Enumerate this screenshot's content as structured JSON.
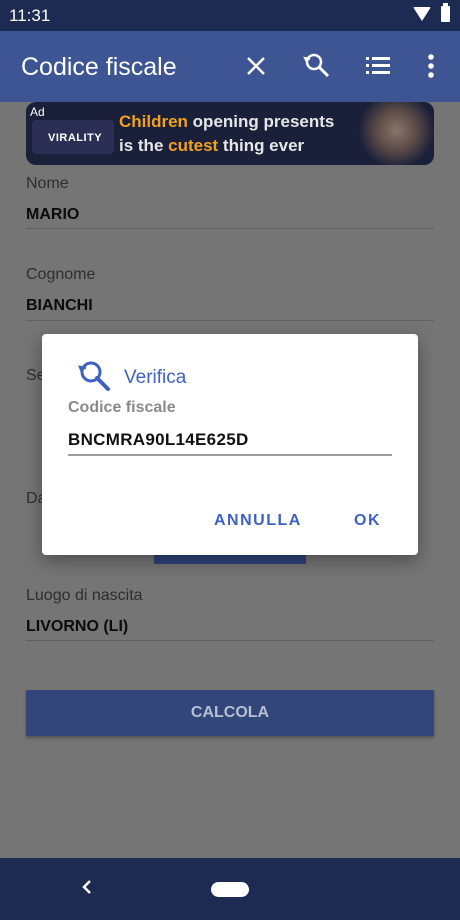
{
  "status_bar": {
    "time": "11:31"
  },
  "app_bar": {
    "title": "Codice fiscale",
    "icons": [
      "close-icon",
      "search-icon",
      "list-icon",
      "more-vert-icon"
    ]
  },
  "ad": {
    "badge": "Ad",
    "brand": "VIRALITY",
    "line1_a": "Children",
    "line1_b": " opening presents",
    "line2_a": "is the ",
    "line2_b": "cutest",
    "line2_c": " thing ever"
  },
  "form": {
    "nome_label": "Nome",
    "nome_value": "MARIO",
    "cognome_label": "Cognome",
    "cognome_value": "BIANCHI",
    "sesso_partial": "Se",
    "data_partial": "Da",
    "luogo_label": "Luogo di nascita",
    "luogo_value": "LIVORNO (LI)",
    "calcola_label": "CALCOLA"
  },
  "dialog": {
    "title": "Verifica",
    "field_label": "Codice fiscale",
    "field_value": "BNCMRA90L14E625D",
    "cancel_label": "ANNULLA",
    "ok_label": "OK"
  },
  "colors": {
    "app_bar": "#3e5593",
    "status_bar": "#1d2a52",
    "accent": "#3e62c3",
    "scrim_content": "#757575"
  }
}
